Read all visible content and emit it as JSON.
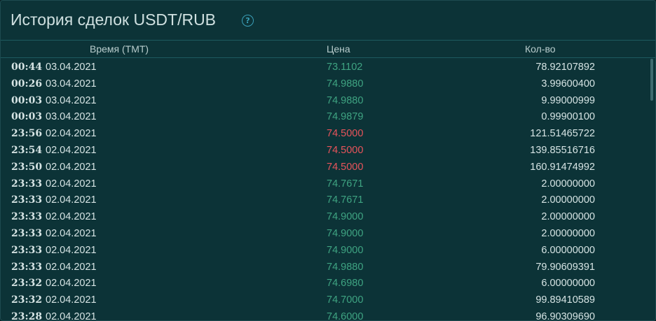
{
  "header": {
    "title": "История сделок USDT/RUB",
    "help_icon": "?"
  },
  "columns": {
    "time": "Время (ТМТ)",
    "price": "Цена",
    "qty": "Кол-во"
  },
  "colors": {
    "buy": "#3fa482",
    "sell": "#e8545b",
    "text": "#d6e4e4",
    "background": "#0c3337"
  },
  "trades": [
    {
      "time": "00:44",
      "date": "03.04.2021",
      "price": "73.1102",
      "side": "buy",
      "qty": "78.92107892"
    },
    {
      "time": "00:26",
      "date": "03.04.2021",
      "price": "74.9880",
      "side": "buy",
      "qty": "3.99600400"
    },
    {
      "time": "00:03",
      "date": "03.04.2021",
      "price": "74.9880",
      "side": "buy",
      "qty": "9.99000999"
    },
    {
      "time": "00:03",
      "date": "03.04.2021",
      "price": "74.9879",
      "side": "buy",
      "qty": "0.99900100"
    },
    {
      "time": "23:56",
      "date": "02.04.2021",
      "price": "74.5000",
      "side": "sell",
      "qty": "121.51465722"
    },
    {
      "time": "23:54",
      "date": "02.04.2021",
      "price": "74.5000",
      "side": "sell",
      "qty": "139.85516716"
    },
    {
      "time": "23:50",
      "date": "02.04.2021",
      "price": "74.5000",
      "side": "sell",
      "qty": "160.91474992"
    },
    {
      "time": "23:33",
      "date": "02.04.2021",
      "price": "74.7671",
      "side": "buy",
      "qty": "2.00000000"
    },
    {
      "time": "23:33",
      "date": "02.04.2021",
      "price": "74.7671",
      "side": "buy",
      "qty": "2.00000000"
    },
    {
      "time": "23:33",
      "date": "02.04.2021",
      "price": "74.9000",
      "side": "buy",
      "qty": "2.00000000"
    },
    {
      "time": "23:33",
      "date": "02.04.2021",
      "price": "74.9000",
      "side": "buy",
      "qty": "2.00000000"
    },
    {
      "time": "23:33",
      "date": "02.04.2021",
      "price": "74.9000",
      "side": "buy",
      "qty": "6.00000000"
    },
    {
      "time": "23:33",
      "date": "02.04.2021",
      "price": "74.9880",
      "side": "buy",
      "qty": "79.90609391"
    },
    {
      "time": "23:32",
      "date": "02.04.2021",
      "price": "74.6980",
      "side": "buy",
      "qty": "6.00000000"
    },
    {
      "time": "23:32",
      "date": "02.04.2021",
      "price": "74.7000",
      "side": "buy",
      "qty": "99.89410589"
    },
    {
      "time": "23:28",
      "date": "02.04.2021",
      "price": "74.6000",
      "side": "buy",
      "qty": "96.90309690"
    }
  ]
}
